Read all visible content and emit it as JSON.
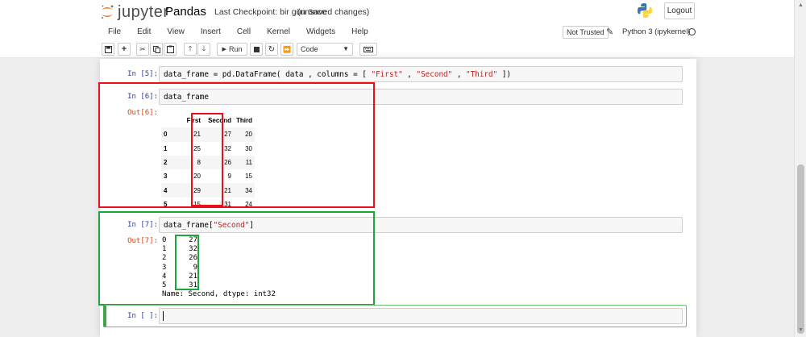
{
  "header": {
    "logo_text": "jupyter",
    "notebook_name": "Pandas",
    "checkpoint": "Last Checkpoint: bir gün önce",
    "unsaved": "(unsaved changes)",
    "logout_label": "Logout"
  },
  "menu": [
    "File",
    "Edit",
    "View",
    "Insert",
    "Cell",
    "Kernel",
    "Widgets",
    "Help"
  ],
  "status": {
    "trust": "Not Trusted",
    "kernel": "Python 3 (ipykernel)"
  },
  "toolbar": {
    "save_icon": "save-icon",
    "add_icon": "plus-icon",
    "cut_icon": "scissors-icon",
    "copy_icon": "copy-icon",
    "paste_icon": "paste-icon",
    "up_icon": "arrow-up-icon",
    "down_icon": "arrow-down-icon",
    "run_label": "Run",
    "cell_type": "Code"
  },
  "cells": {
    "c5": {
      "prompt": "In [5]:",
      "code_prefix": "data_frame = pd.DataFrame( data , columns = [ ",
      "s1": "\"First\"",
      "sep1": " , ",
      "s2": "\"Second\"",
      "sep2": " , ",
      "s3": "\"Third\"",
      "code_suffix": " ])"
    },
    "c6": {
      "prompt": "In [6]:",
      "code": "data_frame",
      "out_prompt": "Out[6]:"
    },
    "c7": {
      "prompt": "In [7]:",
      "code_prefix": "data_frame[",
      "code_str": "\"Second\"",
      "code_suffix": "]",
      "out_prompt": "Out[7]:"
    },
    "c8": {
      "prompt": "In [ ]:"
    }
  },
  "dataframe": {
    "columns": [
      "First",
      "Second",
      "Third"
    ],
    "rows": [
      {
        "idx": "0",
        "vals": [
          "21",
          "27",
          "20"
        ]
      },
      {
        "idx": "1",
        "vals": [
          "25",
          "32",
          "30"
        ]
      },
      {
        "idx": "2",
        "vals": [
          "8",
          "26",
          "11"
        ]
      },
      {
        "idx": "3",
        "vals": [
          "20",
          "9",
          "15"
        ]
      },
      {
        "idx": "4",
        "vals": [
          "29",
          "21",
          "34"
        ]
      },
      {
        "idx": "5",
        "vals": [
          "15",
          "31",
          "24"
        ]
      }
    ]
  },
  "series": {
    "rows": [
      {
        "idx": "0",
        "val": "27"
      },
      {
        "idx": "1",
        "val": "32"
      },
      {
        "idx": "2",
        "val": "26"
      },
      {
        "idx": "3",
        "val": "9"
      },
      {
        "idx": "4",
        "val": "21"
      },
      {
        "idx": "5",
        "val": "31"
      }
    ],
    "meta": "Name: Second, dtype: int32"
  }
}
